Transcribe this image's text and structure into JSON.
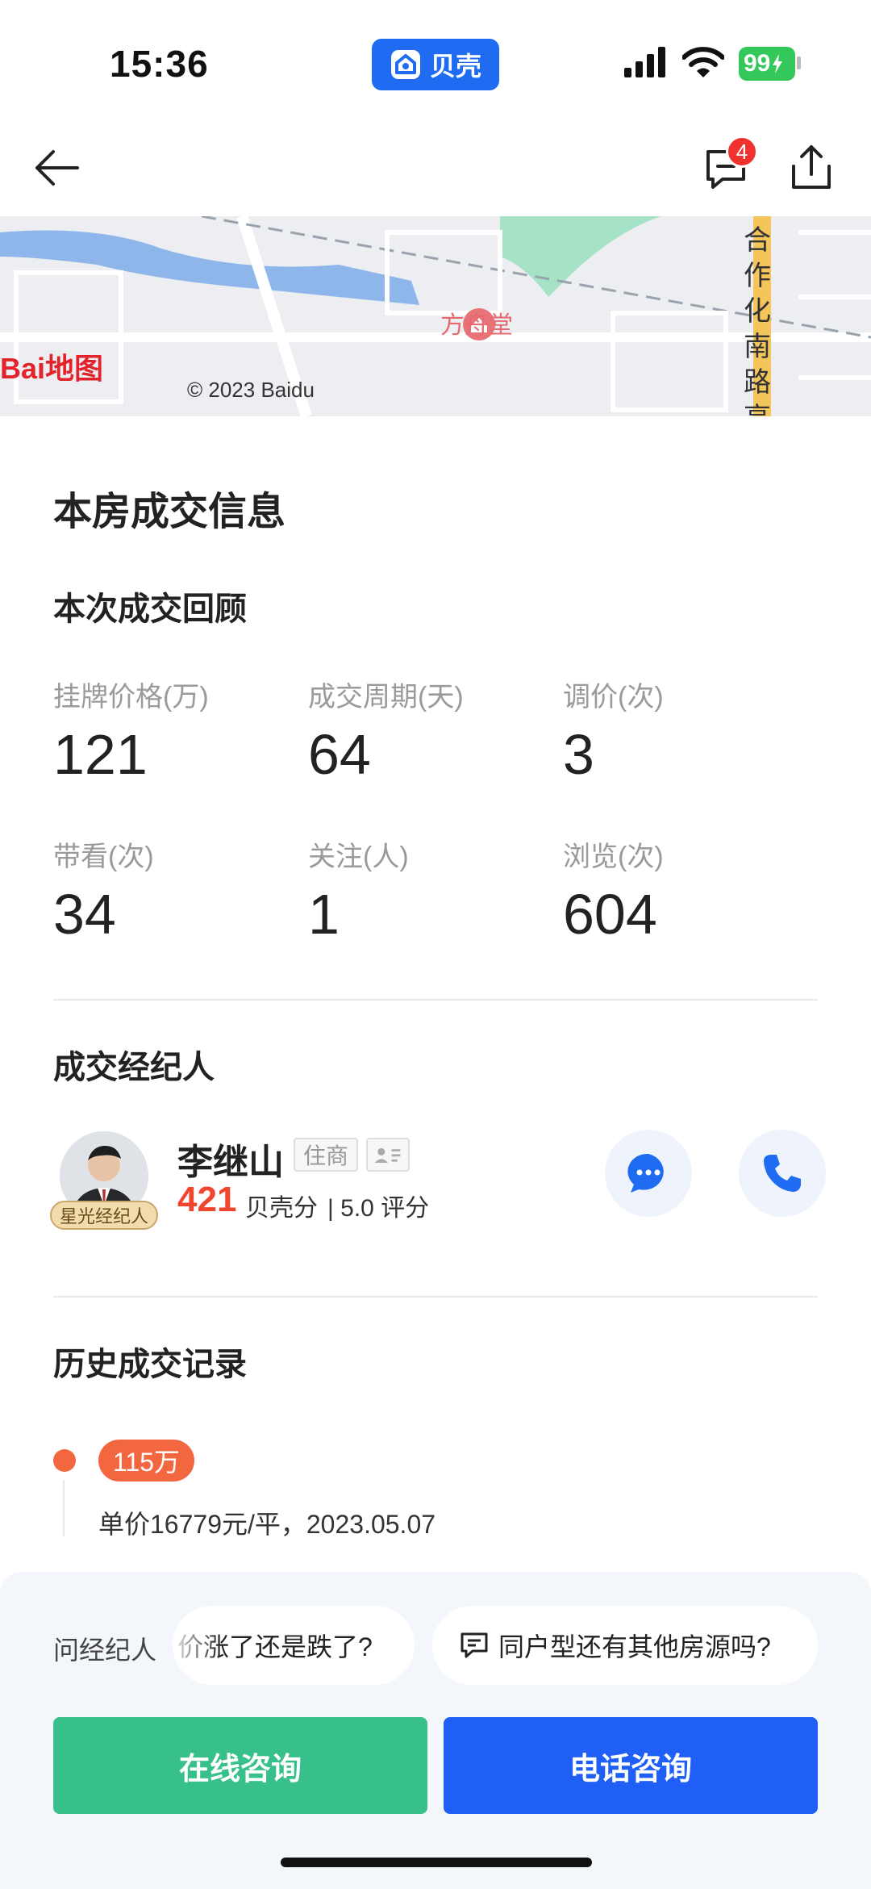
{
  "status_bar": {
    "time": "15:36",
    "app_name": "贝壳",
    "battery": "99"
  },
  "nav": {
    "message_badge": "4"
  },
  "map": {
    "poi": "方舟堂",
    "road": "合作化南路高架",
    "logo_text": "Bai地图",
    "copyright": "© 2023 Baidu"
  },
  "deal": {
    "title": "本房成交信息",
    "review_title": "本次成交回顾",
    "stats": [
      {
        "label": "挂牌价格(万)",
        "value": "121"
      },
      {
        "label": "成交周期(天)",
        "value": "64"
      },
      {
        "label": "调价(次)",
        "value": "3"
      },
      {
        "label": "带看(次)",
        "value": "34"
      },
      {
        "label": "关注(人)",
        "value": "1"
      },
      {
        "label": "浏览(次)",
        "value": "604"
      }
    ]
  },
  "agent": {
    "section_title": "成交经纪人",
    "badge": "星光经纪人",
    "name": "李继山",
    "tag": "住商",
    "score": "421",
    "score_label": "贝壳分",
    "rating": "| 5.0 评分"
  },
  "history": {
    "title": "历史成交记录",
    "records": [
      {
        "price": "115万",
        "detail": "单价16779元/平，2023.05.07"
      }
    ]
  },
  "bottom": {
    "ask_label": "问经纪人",
    "questions": [
      "价涨了还是跌了?",
      "同户型还有其他房源吗?"
    ],
    "online_button": "在线咨询",
    "phone_button": "电话咨询"
  },
  "colors": {
    "brand_blue": "#1f6bf2",
    "accent_orange": "#f26640",
    "green_button": "#37c08a"
  }
}
